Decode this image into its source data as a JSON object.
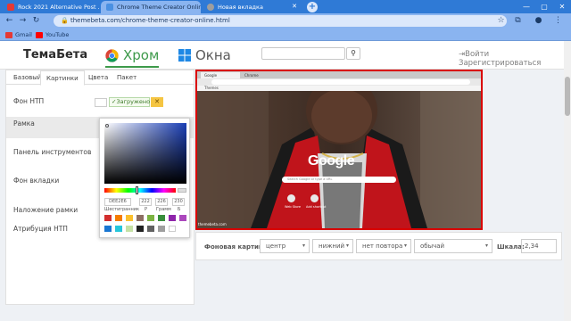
{
  "browser": {
    "tabs": [
      {
        "title": "Rock 2021 Alternative Post ... ×",
        "favicon_color": "#e53935"
      },
      {
        "title": "Chrome Theme Creator Online — созд...",
        "favicon_color": "#4a90e2"
      },
      {
        "title": "Новая вкладка",
        "favicon_color": "#9e9e9e"
      }
    ],
    "url": "themebeta.com/chrome-theme-creator-online.html",
    "bookmarks": [
      {
        "label": "Gmail",
        "icon": "gmail-icon"
      },
      {
        "label": "YouTube",
        "icon": "youtube-icon"
      }
    ],
    "accent": "#2f7ad6"
  },
  "site": {
    "logo": "ТемаБета",
    "tab_chrome": "Хром",
    "tab_windows": "Окна",
    "login": "Войти Зарегистрироваться"
  },
  "editor": {
    "tabs": [
      "Базовый",
      "Картинки",
      "Цвета",
      "Пакет"
    ],
    "active_tab": "Картинки",
    "rows": [
      "Фон НТП",
      "Рамка",
      "Панель инструментов",
      "Фон вкладки",
      "Наложение рамки",
      "Атрибуция НТП"
    ],
    "upload_status": "Загружено",
    "upload_close": "✕"
  },
  "picker": {
    "hex": "DEE2E6",
    "r": "222",
    "g": "226",
    "b": "230",
    "labels": {
      "hex": "Шестигранник",
      "r": "Р",
      "g": "Грамм",
      "b": "Б"
    },
    "swatches": [
      "#d32f2f",
      "#f57c00",
      "#fbc02d",
      "#8d6e63",
      "#7cb342",
      "#388e3c",
      "#8e24aa",
      "#ab47bc",
      "#1976d2",
      "#26c6da",
      "#c5e1a5",
      "#212121",
      "#616161",
      "#9e9e9e",
      "#ffffff"
    ]
  },
  "preview": {
    "tab1": "Google",
    "tab2": "Chrome",
    "bookmark": "Themes",
    "google": "Google",
    "search_placeholder": "Search Google or type a URL",
    "shortcut1": "Web Store",
    "shortcut2": "Add shortcut",
    "footer": "themebeta.com"
  },
  "background": {
    "label": "Фоновая картинка:",
    "position_x": "центр",
    "position_y": "нижний",
    "repeat": "нет повтора",
    "size": "обычай",
    "scale_label": "Шкала:",
    "scale_value": "2,34"
  }
}
